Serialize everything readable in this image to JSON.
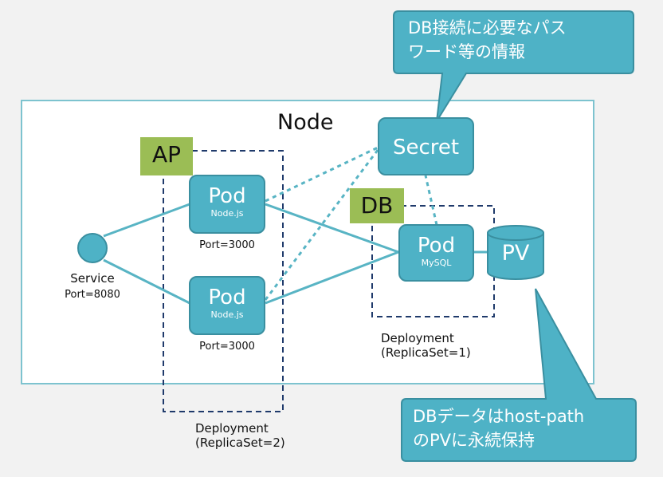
{
  "node": {
    "title": "Node"
  },
  "callout_top": {
    "lines": [
      "DB接続に必要なパス",
      "ワード等の情報"
    ]
  },
  "callout_bottom": {
    "lines": [
      "DBデータはhost-path",
      "のPVに永続保持"
    ]
  },
  "secret": {
    "label": "Secret"
  },
  "service": {
    "label": "Service",
    "port": "Port=8080"
  },
  "ap_group": {
    "tag": "AP",
    "deployment_lines": [
      "Deployment",
      "(ReplicaSet=2)"
    ],
    "pods": [
      {
        "title": "Pod",
        "sub": "Node.js",
        "port": "Port=3000"
      },
      {
        "title": "Pod",
        "sub": "Node.js",
        "port": "Port=3000"
      }
    ]
  },
  "db_group": {
    "tag": "DB",
    "deployment_lines": [
      "Deployment",
      "(ReplicaSet=1)"
    ],
    "pod": {
      "title": "Pod",
      "sub": "MySQL"
    }
  },
  "pv": {
    "label": "PV"
  },
  "colors": {
    "teal": "#4eb2c6",
    "teal_border": "#3a8fa0",
    "line": "#58b4c4",
    "tag_green": "#9bbd55",
    "frame": "#7dc3cf",
    "dashed_box": "#1f3a6b"
  }
}
